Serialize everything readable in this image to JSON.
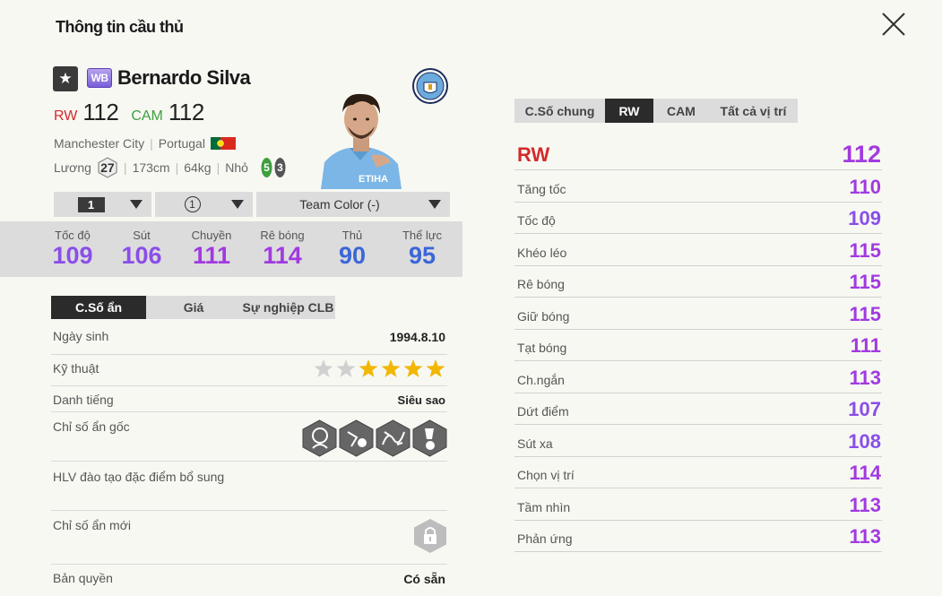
{
  "modal": {
    "title": "Thông tin cầu thủ"
  },
  "player": {
    "name": "Bernardo Silva",
    "season_badge": "WB",
    "positions": [
      {
        "code": "RW",
        "value": "112",
        "color": "#d42a2a"
      },
      {
        "code": "CAM",
        "value": "112",
        "color": "#3f9e3f"
      }
    ],
    "club": "Manchester City",
    "nation": "Portugal",
    "salary_label": "Lương",
    "salary": "27",
    "height": "173cm",
    "weight": "64kg",
    "body_type": "Nhỏ",
    "foot_left": "5",
    "foot_right": "3"
  },
  "selectors": {
    "upgrade": "1",
    "team_color_level": "1",
    "team_color": "Team Color (-)"
  },
  "summary_stats": [
    {
      "label": "Tốc độ",
      "value": "109",
      "color": "#8a4ee8"
    },
    {
      "label": "Sút",
      "value": "106",
      "color": "#8a4ee8"
    },
    {
      "label": "Chuyền",
      "value": "111",
      "color": "#a13ae0"
    },
    {
      "label": "Rê bóng",
      "value": "114",
      "color": "#a13ae0"
    },
    {
      "label": "Thủ",
      "value": "90",
      "color": "#3b66d8"
    },
    {
      "label": "Thể lực",
      "value": "95",
      "color": "#3b66d8"
    }
  ],
  "sub_tabs": [
    "C.Số ẩn",
    "Giá",
    "Sự nghiệp CLB"
  ],
  "info": {
    "birth_label": "Ngày sinh",
    "birth_value": "1994.8.10",
    "skill_label": "Kỹ thuật",
    "skill_stars": 5,
    "skill_max": 7,
    "fame_label": "Danh tiếng",
    "fame_value": "Siêu sao",
    "traits_label": "Chỉ số ẩn gốc",
    "trait_icons": [
      "playmaker-trait-icon",
      "dribbler-trait-icon",
      "passing-trait-icon",
      "finesse-shot-trait-icon"
    ],
    "coach_label": "HLV đào tạo đặc điểm bổ sung",
    "new_traits_label": "Chỉ số ẩn mới",
    "rights_label": "Bản quyền",
    "rights_value": "Có sẵn"
  },
  "right_tabs": [
    "C.Số chung",
    "RW",
    "CAM",
    "Tất cả vị trí"
  ],
  "detail_header": {
    "label": "RW",
    "value": "112"
  },
  "detail_stats": [
    {
      "label": "Tăng tốc",
      "value": "110",
      "color": "#a13ae0"
    },
    {
      "label": "Tốc độ",
      "value": "109",
      "color": "#8a4ee8"
    },
    {
      "label": "Khéo léo",
      "value": "115",
      "color": "#a13ae0"
    },
    {
      "label": "Rê bóng",
      "value": "115",
      "color": "#a13ae0"
    },
    {
      "label": "Giữ bóng",
      "value": "115",
      "color": "#a13ae0"
    },
    {
      "label": "Tạt bóng",
      "value": "111",
      "color": "#a13ae0"
    },
    {
      "label": "Ch.ngắn",
      "value": "113",
      "color": "#a13ae0"
    },
    {
      "label": "Dứt điểm",
      "value": "107",
      "color": "#8a4ee8"
    },
    {
      "label": "Sút xa",
      "value": "108",
      "color": "#8a4ee8"
    },
    {
      "label": "Chọn vị trí",
      "value": "114",
      "color": "#a13ae0"
    },
    {
      "label": "Tầm nhìn",
      "value": "113",
      "color": "#a13ae0"
    },
    {
      "label": "Phản ứng",
      "value": "113",
      "color": "#a13ae0"
    }
  ],
  "colors": {
    "star_filled": "#f2b705",
    "star_empty": "#d0d0d0",
    "active_tab": "#2b2b2b"
  }
}
